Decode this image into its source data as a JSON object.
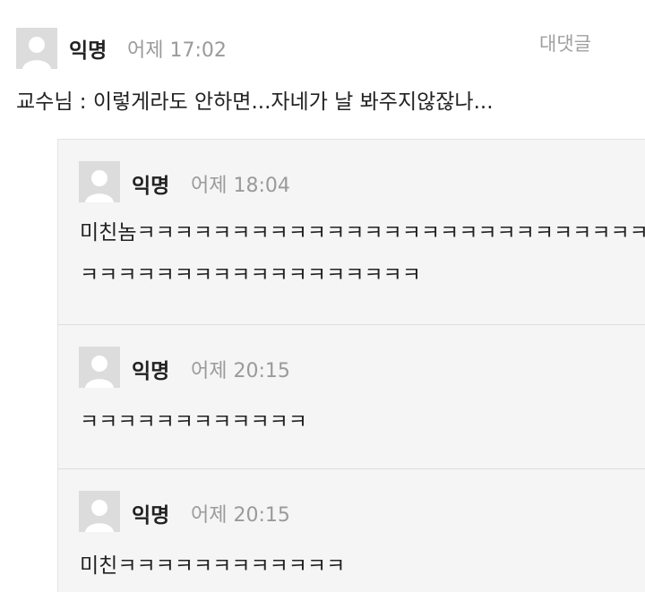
{
  "main_comment": {
    "author": "익명",
    "time": "어제 17:02",
    "reply_label": "대댓글",
    "text": "교수님 : 이렇게라도 안하면...자네가 날 봐주지않잖나..."
  },
  "replies": [
    {
      "author": "익명",
      "time": "어제 18:04",
      "lines": [
        "미친놈ㅋㅋㅋㅋㅋㅋㅋㅋㅋㅋㅋㅋㅋㅋㅋㅋㅋㅋㅋㅋㅋㅋㅋㅋㅋㅋㅋ",
        "ㅋㅋㅋㅋㅋㅋㅋㅋㅋㅋㅋㅋㅋㅋㅋㅋㅋㅋ"
      ]
    },
    {
      "author": "익명",
      "time": "어제 20:15",
      "lines": [
        "ㅋㅋㅋㅋㅋㅋㅋㅋㅋㅋㅋㅋ"
      ]
    },
    {
      "author": "익명",
      "time": "어제 20:15",
      "lines": [
        "미친ㅋㅋㅋㅋㅋㅋㅋㅋㅋㅋㅋㅋ"
      ]
    }
  ]
}
